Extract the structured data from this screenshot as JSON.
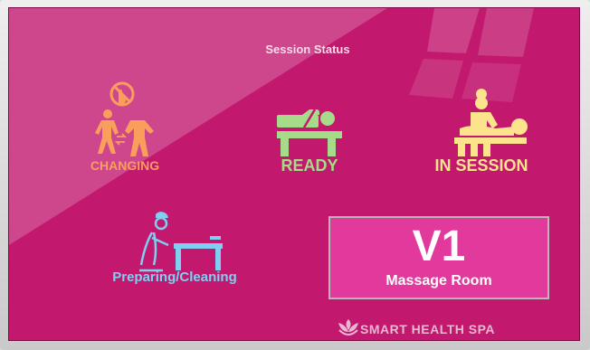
{
  "panel": {
    "title": "Session Status"
  },
  "statuses": {
    "changing": {
      "label": "CHANGING",
      "color": "#f99f5b"
    },
    "ready": {
      "label": "READY",
      "color": "#a6db8a"
    },
    "in_session": {
      "label": "IN SESSION",
      "color": "#fde48c"
    },
    "preparing": {
      "label": "Preparing/Cleaning",
      "color": "#7fcff2"
    }
  },
  "room": {
    "code": "V1",
    "name": "Massage Room"
  },
  "brand": {
    "name": "SMART  HEALTH SPA",
    "logo_icon": "lotus-hands-icon"
  },
  "colors": {
    "background": "#c2186e",
    "room_box": "#e2399c"
  }
}
